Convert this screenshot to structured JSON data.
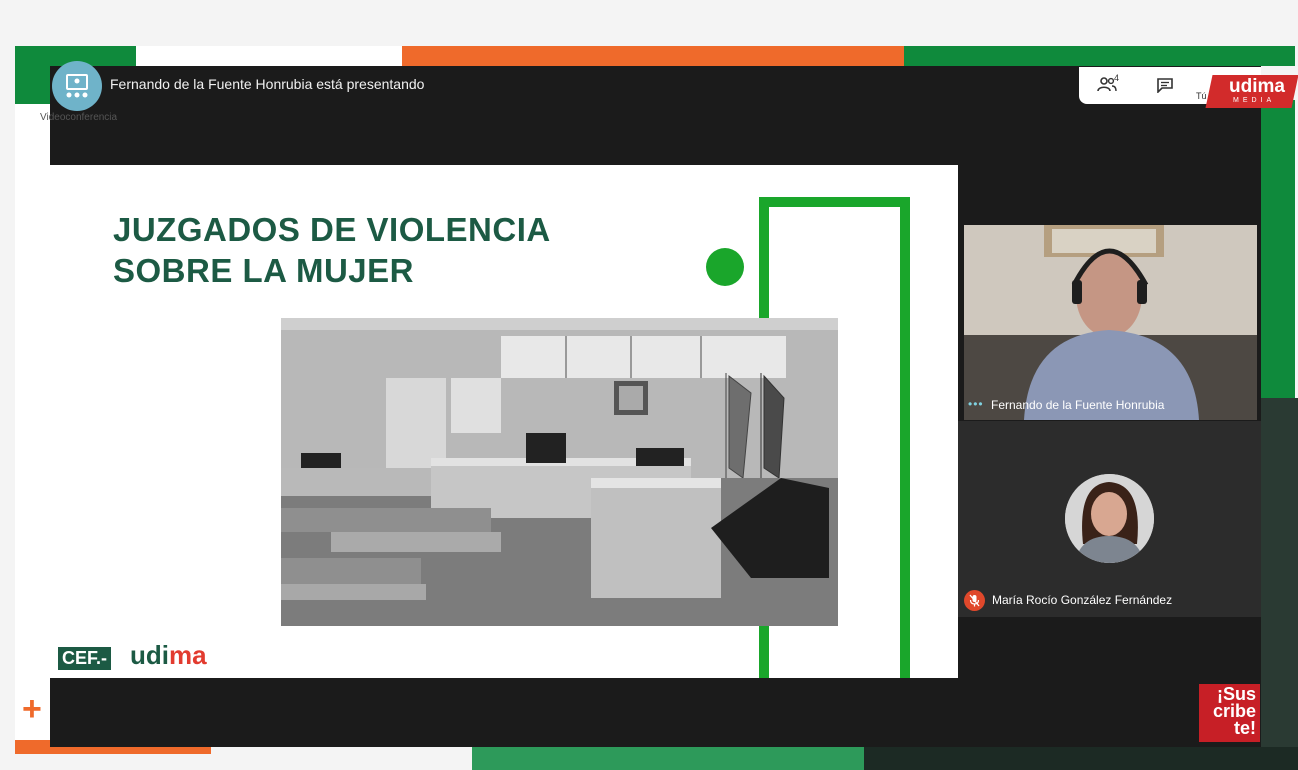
{
  "header": {
    "presenting_text": "Fernando de la Fuente Honrubia está presentando",
    "app_label": "Videoconferencia",
    "participant_count": "4",
    "self_label": "Tú"
  },
  "brand": {
    "badge": "udima",
    "badge_sub": "MEDIA"
  },
  "slide": {
    "title_line1": "JUZGADOS DE VIOLENCIA",
    "title_line2": "SOBRE LA MUJER",
    "logo_cef": "CEF.-",
    "logo_udima_a": "udi",
    "logo_udima_b": "ma"
  },
  "participants": [
    {
      "name": "Fernando de la Fuente Honrubia",
      "speaking": true
    },
    {
      "name": "María Rocío González Fernández",
      "muted": true
    }
  ],
  "overlay": {
    "subscribe_1": "¡Sus",
    "subscribe_2": "cribe",
    "subscribe_3": "te!",
    "plus": "+"
  },
  "colors": {
    "frame_green": "#0f8a3c",
    "frame_orange": "#ef6a2b",
    "slide_green": "#1aa62b",
    "title_green": "#1c5a44",
    "brand_red": "#d22b2b"
  }
}
